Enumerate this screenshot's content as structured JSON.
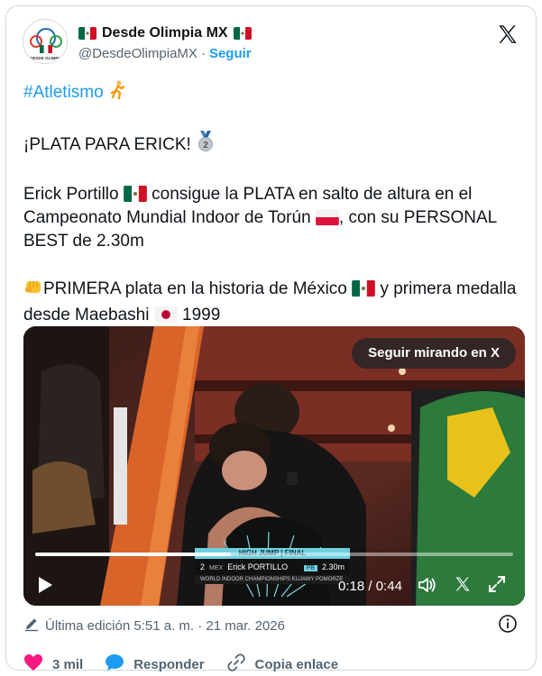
{
  "author": {
    "display_name": "Desde Olimpia MX",
    "handle": "@DesdeOlimpiaMX",
    "separator": "·",
    "follow_label": "Seguir",
    "avatar_label": "DESDE OLIMPIA"
  },
  "tweet": {
    "hashtag": "#Atletismo",
    "line_headline": "¡PLATA PARA ERICK!",
    "para1_a": "Erick Portillo",
    "para1_b": "consigue la PLATA en salto de altura en el Campeonato Mundial Indoor de Torún",
    "para1_c": ", con su PERSONAL BEST de 2.30m",
    "para2_a": "PRIMERA plata en la historia de México",
    "para2_b": "y primera medalla desde Maebashi",
    "para2_c": "1999"
  },
  "video": {
    "keep_watching_label": "Seguir mirando en X",
    "time_current": "0:18",
    "time_total": "0:44",
    "time_sep": " / ",
    "progress_fraction": 0.41,
    "overlay": {
      "event": "HIGH JUMP | FINAL",
      "rank": "2",
      "country": "MEX",
      "athlete": "Erick PORTILLO",
      "badge": "PB",
      "mark": "2.30m",
      "championship": "WORLD INDOOR CHAMPIONSHIPS KUJAWY POMORZE"
    }
  },
  "meta": {
    "edited_label": "Última edición 5:51 a. m. · 21 mar. 2026"
  },
  "actions": {
    "likes": "3 mil",
    "reply_label": "Responder",
    "copy_label": "Copia enlace"
  },
  "colors": {
    "accent": "#1d9bf0",
    "like": "#f91880",
    "text": "#0f1419",
    "muted": "#536471"
  },
  "icons": {
    "x_logo": "x-logo-icon",
    "runner": "runner-emoji-icon",
    "medal": "silver-medal-icon",
    "fist": "fist-emoji-icon",
    "flag_mx": "mexico-flag-icon",
    "flag_pl": "poland-flag-icon",
    "flag_jp": "japan-flag-icon",
    "play": "play-icon",
    "volume": "volume-icon",
    "expand": "fullscreen-icon",
    "pencil": "edit-pencil-icon",
    "info": "info-icon",
    "heart": "heart-icon",
    "reply": "reply-bubble-icon",
    "link": "link-icon"
  }
}
